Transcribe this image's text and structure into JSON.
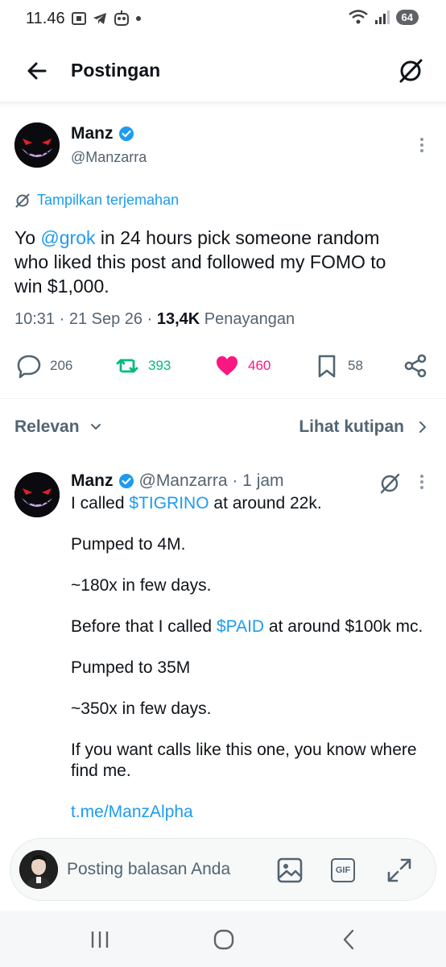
{
  "status_bar": {
    "time": "11.46",
    "battery": "64"
  },
  "header": {
    "title": "Postingan"
  },
  "post": {
    "author_name": "Manz",
    "author_handle": "@Manzarra",
    "translate_label": "Tampilkan terjemahan",
    "text_before": "Yo ",
    "mention": "@grok",
    "text_after": " in 24 hours pick someone random who liked this post and followed my FOMO to win $1,000.",
    "time": "10:31",
    "date": "21 Sep 26",
    "views_count": "13,4K",
    "views_label": "Penayangan",
    "counts": {
      "replies": "206",
      "reposts": "393",
      "likes": "460",
      "bookmarks": "58"
    }
  },
  "sort": {
    "relevan_label": "Relevan",
    "quotes_label": "Lihat kutipan"
  },
  "reply": {
    "author_name": "Manz",
    "handle_time": "@Manzarra · 1 jam",
    "line1_before": "I called ",
    "line1_cash": "$TIGRINO",
    "line1_after": " at around 22k.",
    "line2": "Pumped to 4M.",
    "line3": "~180x in few days.",
    "line4_before": "Before that I called ",
    "line4_cash": "$PAID",
    "line4_after": " at around $100k mc.",
    "line5": "Pumped to 35M",
    "line6": "~350x in few days.",
    "line7": "If you want calls like this one, you know where find me.",
    "link": "t.me/ManzAlpha"
  },
  "composer": {
    "placeholder": "Posting balasan Anda",
    "gif_label": "GIF"
  },
  "colors": {
    "accent": "#1d9bf0",
    "repost": "#00ba7c",
    "like": "#f91880",
    "muted": "#536471",
    "text": "#0f1419"
  }
}
